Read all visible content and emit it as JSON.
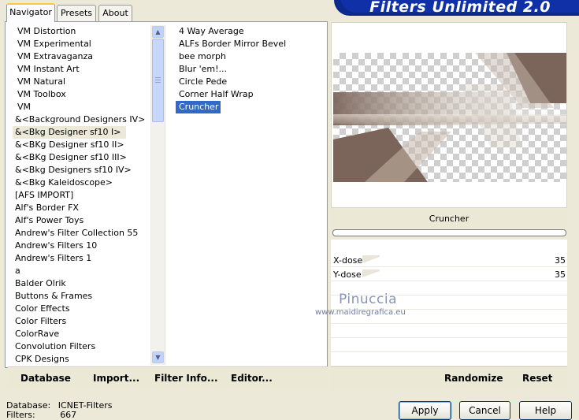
{
  "tabs": [
    {
      "label": "Navigator",
      "active": true
    },
    {
      "label": "Presets",
      "active": false
    },
    {
      "label": "About",
      "active": false
    }
  ],
  "banner_title": "Filters Unlimited 2.0",
  "categories": [
    "VM Distortion",
    "VM Experimental",
    "VM Extravaganza",
    "VM Instant Art",
    "VM Natural",
    "VM Toolbox",
    "VM",
    "&<Background Designers IV>",
    "&<Bkg Designer sf10 I>",
    "&<BKg Designer sf10 II>",
    "&<BKg Designer sf10 III>",
    "&<Bkg Designers sf10 IV>",
    "&<Bkg Kaleidoscope>",
    "[AFS IMPORT]",
    "Alf's Border FX",
    "Alf's Power Toys",
    "Andrew's Filter Collection 55",
    "Andrew's Filters 10",
    "Andrew's Filters 1",
    "a",
    "Balder Olrik",
    "Buttons & Frames",
    "Color Effects",
    "Color Filters",
    "ColorRave",
    "Convolution Filters",
    "CPK Designs"
  ],
  "selected_category_index": 8,
  "filters": [
    "4 Way Average",
    "ALFs Border Mirror Bevel",
    "bee morph",
    "Blur 'em!...",
    "Circle Pede",
    "Corner Half Wrap",
    "Cruncher"
  ],
  "selected_filter_index": 6,
  "nav_buttons": {
    "database": "Database",
    "import": "Import...",
    "filter_info": "Filter Info...",
    "editor": "Editor..."
  },
  "preview": {
    "filter_name": "Cruncher",
    "params": [
      {
        "label": "X-dose",
        "value": "35"
      },
      {
        "label": "Y-dose",
        "value": "35"
      }
    ],
    "watermark": "Pinuccia",
    "watermark_url": "www.maidiregrafica.eu"
  },
  "right_buttons": {
    "randomize": "Randomize",
    "reset": "Reset"
  },
  "status": {
    "database_label": "Database:",
    "database_value": "ICNET-Filters",
    "filters_label": "Filters:",
    "filters_value": "667"
  },
  "dialog_buttons": {
    "apply": "Apply",
    "cancel": "Cancel",
    "help": "Help"
  },
  "colors": {
    "selection": "#316ac5",
    "banner": "#0b2a8c",
    "dialog_bg": "#ece9d8",
    "preview_brown": "#7b655a"
  }
}
